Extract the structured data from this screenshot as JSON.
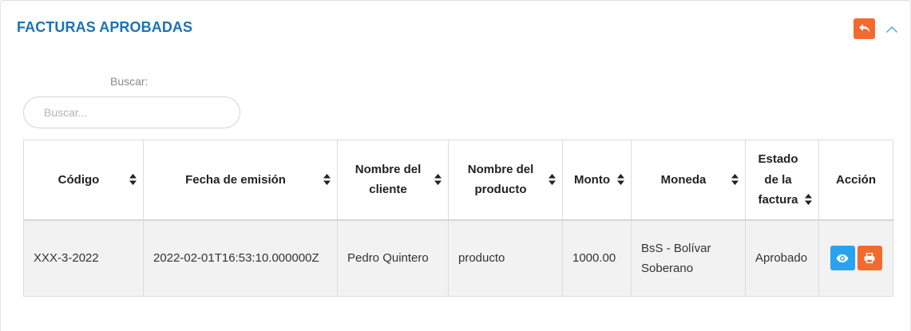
{
  "panel": {
    "title": "FACTURAS APROBADAS",
    "back_icon": "reply-icon",
    "collapse_icon": "chevron-up-icon",
    "accent_color": "#1a73b8",
    "orange_color": "#f26a2e",
    "blue_color": "#2aa3ef"
  },
  "search": {
    "label": "Buscar:",
    "placeholder": "Buscar...",
    "value": ""
  },
  "table": {
    "columns": [
      {
        "label": "Código"
      },
      {
        "label": "Fecha de emisión"
      },
      {
        "label": "Nombre del cliente"
      },
      {
        "label": "Nombre del producto"
      },
      {
        "label": "Monto"
      },
      {
        "label": "Moneda"
      },
      {
        "label": "Estado de la factura"
      },
      {
        "label": "Acción"
      }
    ],
    "rows": [
      {
        "codigo": "XXX-3-2022",
        "fecha": "2022-02-01T16:53:10.000000Z",
        "cliente": "Pedro Quintero",
        "producto": "producto",
        "monto": "1000.00",
        "moneda": "BsS - Bolívar Soberano",
        "estado": "Aprobado",
        "actions": [
          "eye-icon",
          "print-icon"
        ]
      }
    ]
  }
}
